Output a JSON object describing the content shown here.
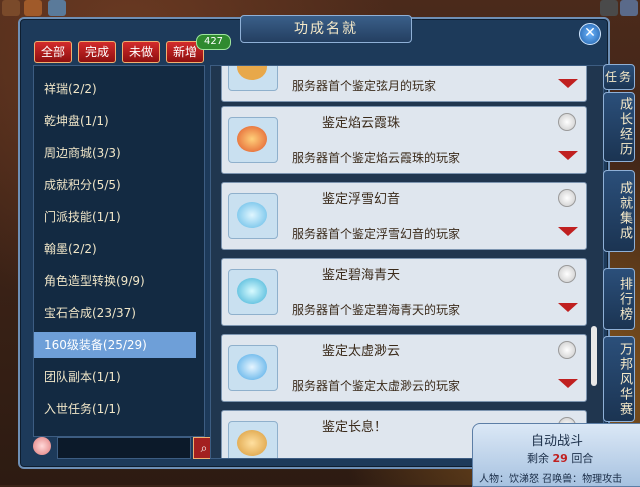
{
  "window": {
    "title": "功成名就",
    "close": "✕"
  },
  "filters": [
    "全部",
    "完成",
    "未做",
    "新增"
  ],
  "new_count": "427",
  "categories": [
    "祥瑞(2/2)",
    "乾坤盘(1/1)",
    "周边商城(3/3)",
    "成就积分(5/5)",
    "门派技能(1/1)",
    "翰墨(2/2)",
    "角色造型转换(9/9)",
    "宝石合成(23/37)",
    "160级装备(25/29)",
    "团队副本(1/1)",
    "入世任务(1/1)"
  ],
  "selected_category": "160级装备(25/29)",
  "search": {
    "placeholder": ""
  },
  "cards": [
    {
      "title": "",
      "desc": "服务器首个鉴定弦月的玩家",
      "gem_color": "#e8a84a"
    },
    {
      "title": "鉴定焰云霞珠",
      "desc": "服务器首个鉴定焰云霞珠的玩家",
      "gem_color": "#e0562a"
    },
    {
      "title": "鉴定浮雪幻音",
      "desc": "服务器首个鉴定浮雪幻音的玩家",
      "gem_color": "#5fb9e6"
    },
    {
      "title": "鉴定碧海青天",
      "desc": "服务器首个鉴定碧海青天的玩家",
      "gem_color": "#3fb0d6"
    },
    {
      "title": "鉴定太虚渺云",
      "desc": "服务器首个鉴定太虚渺云的玩家",
      "gem_color": "#4aa8e6"
    },
    {
      "title": "鉴定长息！",
      "desc": "",
      "gem_color": "#d89a3a"
    }
  ],
  "side_tabs": [
    "任务追",
    "成长经历",
    "成就集成",
    "排行榜",
    "万邦风华赛"
  ],
  "auto_battle": {
    "title": "自动战斗",
    "remaining_label": "剩余",
    "rounds": "29",
    "rounds_label": "回合",
    "bottom": "人物：饮涕怒 召唤兽：物理攻击"
  }
}
